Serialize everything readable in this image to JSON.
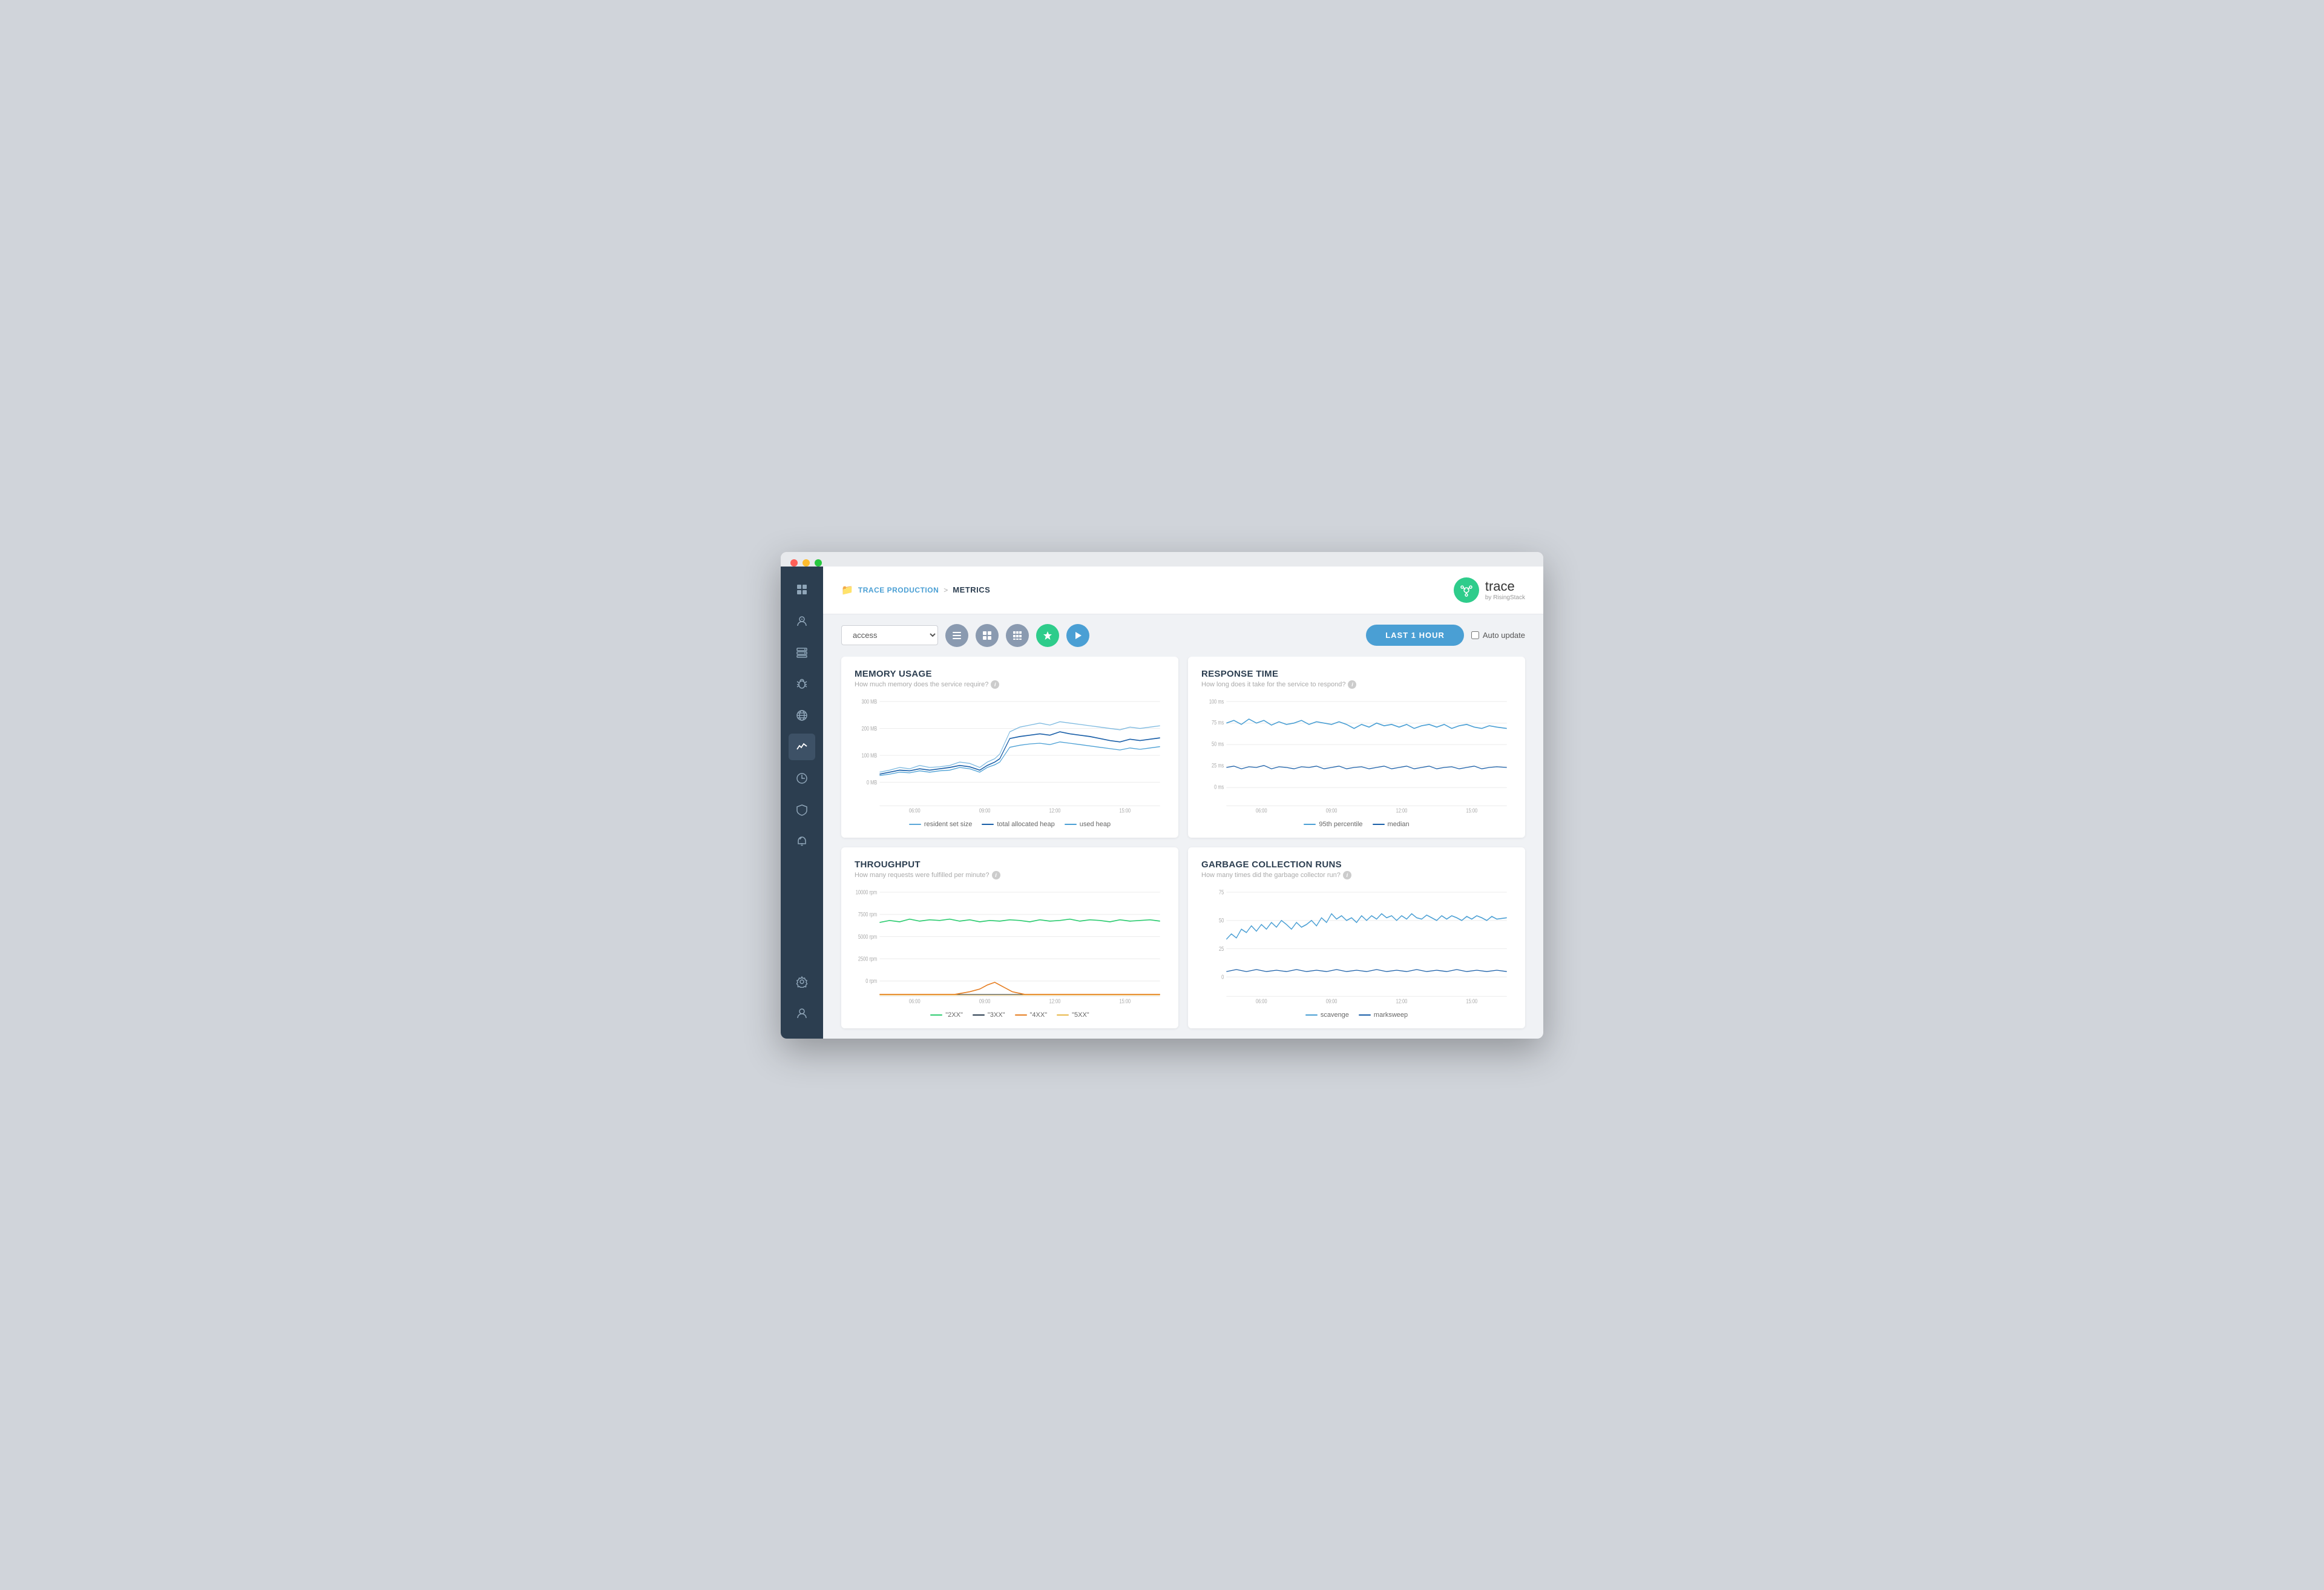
{
  "browser": {
    "dots": [
      "red",
      "yellow",
      "green"
    ]
  },
  "header": {
    "breadcrumb_folder_icon": "📁",
    "breadcrumb_service": "TRACE PRODUCTION",
    "breadcrumb_sep": ">",
    "breadcrumb_current": "METRICS",
    "logo_text": "trace",
    "logo_sub": "by RisingStack"
  },
  "toolbar": {
    "service_value": "access",
    "time_btn": "LAST 1 HOUR",
    "auto_update_label": "Auto update"
  },
  "charts": {
    "memory_usage": {
      "title": "MEMORY USAGE",
      "subtitle": "How much memory does the service require?",
      "y_labels": [
        "300 MB",
        "200 MB",
        "100 MB",
        "0 MB"
      ],
      "x_labels": [
        "06:00",
        "09:00",
        "12:00",
        "15:00"
      ],
      "legend": [
        {
          "label": "resident set size",
          "color": "#5ba7d8"
        },
        {
          "label": "total allocated heap",
          "color": "#1a5fa8"
        },
        {
          "label": "used heap",
          "color": "#4a9fd4"
        }
      ]
    },
    "response_time": {
      "title": "RESPONSE TIME",
      "subtitle": "How long does it take for the service to respond?",
      "y_labels": [
        "100 ms",
        "75 ms",
        "50 ms",
        "25 ms",
        "0 ms"
      ],
      "x_labels": [
        "06:00",
        "09:00",
        "12:00",
        "15:00"
      ],
      "legend": [
        {
          "label": "95th percentile",
          "color": "#4a9fd4"
        },
        {
          "label": "median",
          "color": "#1a5fa8"
        }
      ]
    },
    "throughput": {
      "title": "THROUGHPUT",
      "subtitle": "How many requests were fulfilled per minute?",
      "y_labels": [
        "10000 rpm",
        "7500 rpm",
        "5000 rpm",
        "2500 rpm",
        "0 rpm"
      ],
      "x_labels": [
        "06:00",
        "09:00",
        "12:00",
        "15:00"
      ],
      "legend": [
        {
          "label": "\"2XX\"",
          "color": "#2ecc71"
        },
        {
          "label": "\"3XX\"",
          "color": "#2c3e50"
        },
        {
          "label": "\"4XX\"",
          "color": "#e67e22"
        },
        {
          "label": "\"5XX\"",
          "color": "#e67e22"
        }
      ]
    },
    "garbage_collection": {
      "title": "GARBAGE COLLECTION RUNS",
      "subtitle": "How many times did the garbage collector run?",
      "y_labels": [
        "75",
        "50",
        "25",
        "0"
      ],
      "x_labels": [
        "06:00",
        "09:00",
        "12:00",
        "15:00"
      ],
      "legend": [
        {
          "label": "scavenge",
          "color": "#4a9fd4"
        },
        {
          "label": "marksweep",
          "color": "#1a5fa8"
        }
      ]
    }
  },
  "sidebar": {
    "icons": [
      {
        "name": "dashboard-icon",
        "symbol": "⊞",
        "active": false
      },
      {
        "name": "users-icon",
        "symbol": "◎",
        "active": false
      },
      {
        "name": "server-icon",
        "symbol": "▤",
        "active": false
      },
      {
        "name": "bug-icon",
        "symbol": "✱",
        "active": false
      },
      {
        "name": "globe-icon",
        "symbol": "⊕",
        "active": false
      },
      {
        "name": "metrics-icon",
        "symbol": "∿",
        "active": true
      },
      {
        "name": "profiler-icon",
        "symbol": "◷",
        "active": false
      },
      {
        "name": "alerts-icon",
        "symbol": "⊘",
        "active": false
      },
      {
        "name": "alerts2-icon",
        "symbol": "◟",
        "active": false
      },
      {
        "name": "settings-icon",
        "symbol": "⚙",
        "active": false
      },
      {
        "name": "user-icon",
        "symbol": "◯",
        "active": false
      }
    ]
  }
}
